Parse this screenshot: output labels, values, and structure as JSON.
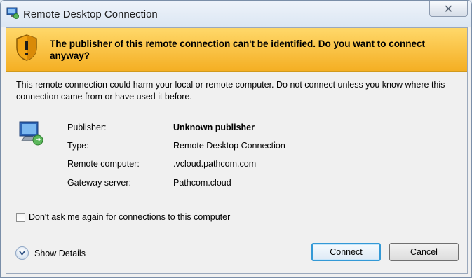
{
  "window": {
    "title": "Remote Desktop Connection",
    "close_label": "✕"
  },
  "banner": {
    "message": "The publisher of this remote connection can't be identified. Do you want to connect anyway?"
  },
  "description": "This remote connection could harm your local or remote computer. Do not connect unless you know where this connection came from or have used it before.",
  "details": [
    {
      "label": "Publisher:",
      "value": "Unknown publisher"
    },
    {
      "label": "Type:",
      "value": "Remote Desktop Connection"
    },
    {
      "label": "Remote computer:",
      "value": ".vcloud.pathcom.com"
    },
    {
      "label": "Gateway server:",
      "value": "Pathcom.cloud"
    }
  ],
  "checkbox": {
    "label": "Don't ask me again for connections to this computer",
    "checked": false
  },
  "show_details": {
    "label": "Show Details"
  },
  "buttons": {
    "connect": "Connect",
    "cancel": "Cancel"
  },
  "colors": {
    "banner_top": "#ffd86a",
    "banner_bottom": "#f4ae22",
    "focus_border": "#3399d6"
  }
}
